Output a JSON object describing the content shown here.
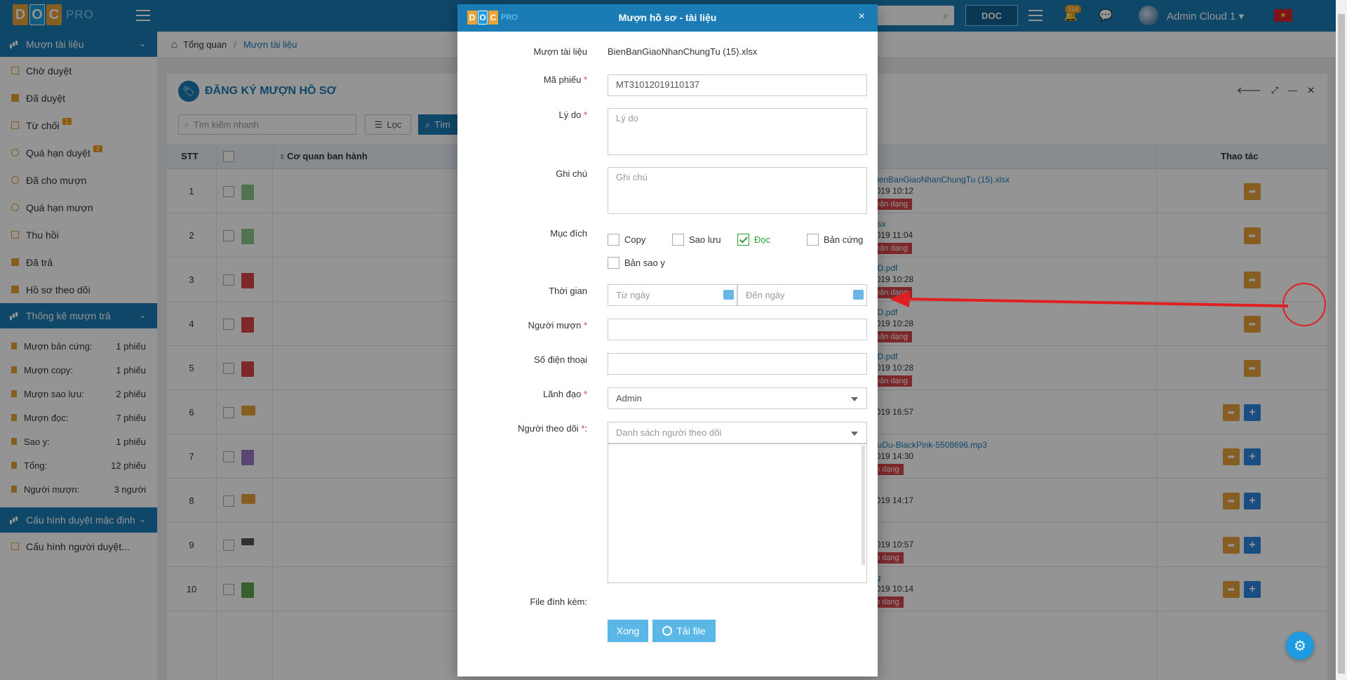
{
  "topbar": {
    "logo_letters": [
      "D",
      "O",
      "C"
    ],
    "logo_suffix": "PRO",
    "logo_colors": [
      "#e8a33a",
      "#1e9be0",
      "#e8a33a"
    ],
    "notification_count": "524",
    "user_name": "Admin Cloud 1",
    "user_caret": "▾"
  },
  "sidebar": {
    "section1": {
      "title": "Mượn tài liệu",
      "chevron": "⌄"
    },
    "items1": [
      {
        "label": "Chờ duyệt",
        "icon": "square-icon",
        "badge": ""
      },
      {
        "label": "Đã duyệt",
        "icon": "checked-square-icon",
        "badge": ""
      },
      {
        "label": "Từ chối",
        "icon": "minus-square-icon",
        "badge": "1"
      },
      {
        "label": "Quá hạn duyệt",
        "icon": "circle-icon",
        "badge": "2"
      },
      {
        "label": "Đã cho mượn",
        "icon": "dot-circle-icon",
        "badge": ""
      },
      {
        "label": "Quá hạn mượn",
        "icon": "circle-icon",
        "badge": ""
      },
      {
        "label": "Thu hồi",
        "icon": "minus-square-icon",
        "badge": ""
      },
      {
        "label": "Đã trả",
        "icon": "checked-square-icon",
        "badge": ""
      },
      {
        "label": "Hồ sơ theo dõi",
        "icon": "checked-square-icon",
        "badge": ""
      }
    ],
    "section2": {
      "title": "Thống kê mượn trả",
      "chevron": "⌄"
    },
    "stats": [
      {
        "label": "Mượn bản cứng:",
        "value": "1 phiếu"
      },
      {
        "label": "Mượn copy:",
        "value": "1 phiếu"
      },
      {
        "label": "Mượn sao lưu:",
        "value": "2 phiếu"
      },
      {
        "label": "Mượn đọc:",
        "value": "7 phiếu"
      },
      {
        "label": "Sao y:",
        "value": "1 phiếu"
      },
      {
        "label": "Tổng:",
        "value": "12 phiếu"
      },
      {
        "label": "Người mượn:",
        "value": "3 người"
      }
    ],
    "section3": {
      "title": "Cấu hình duyệt mặc định",
      "chevron": "⌄"
    },
    "items3": [
      {
        "label": "Cấu hình người duyệt..."
      }
    ]
  },
  "breadcrumb": {
    "home": "Tổng quan",
    "sep": "/",
    "current": "Mượn tài liệu"
  },
  "panel": {
    "title": "ĐĂNG KÝ MƯỢN HỒ SƠ",
    "quick_search_placeholder": "Tìm kiếm nhanh",
    "filter_label": "Lọc",
    "search_label": "Tìm",
    "columns": {
      "stt": "STT",
      "agency": "Cơ quan ban hành",
      "actions": "Thao tác"
    },
    "rows": [
      {
        "stt": "1",
        "type": "xls",
        "name": "BienBanGiaoNhanChungTu (15).xlsx",
        "date": "2019 10:12",
        "status": "hận dạng",
        "plus": false
      },
      {
        "stt": "2",
        "type": "xls",
        "name": "xlsx",
        "date": "2019 11:04",
        "status": "hận dạng",
        "plus": false
      },
      {
        "stt": "3",
        "type": "pdf",
        "name": "ND.pdf",
        "date": "2019 10:28",
        "status": "hận dạng",
        "plus": false
      },
      {
        "stt": "4",
        "type": "pdf",
        "name": "ND.pdf",
        "date": "2019 10:28",
        "status": "hận dạng",
        "plus": false
      },
      {
        "stt": "5",
        "type": "pdf",
        "name": "ND.pdf",
        "date": "2019 10:28",
        "status": "hận dạng",
        "plus": false
      },
      {
        "stt": "6",
        "type": "folder",
        "name": "",
        "date": "2019 16:57",
        "status": "",
        "plus": true
      },
      {
        "stt": "7",
        "type": "mp3",
        "name": "DuDu-BlackPink-5508696.mp3",
        "date": "2019 14:30",
        "status": "n dạng",
        "plus": true
      },
      {
        "stt": "8",
        "type": "folder",
        "name": "",
        "date": "2019 14:17",
        "status": "",
        "plus": true
      },
      {
        "stt": "9",
        "type": "exe",
        "name": "",
        "date": "2019 10:57",
        "status": "n dạng",
        "plus": true
      },
      {
        "stt": "10",
        "type": "img",
        "name": "ng",
        "date": "2019 10:14",
        "status": "n dạng",
        "plus": true
      }
    ]
  },
  "modal": {
    "title": "Mượn hồ sơ - tài liệu",
    "close": "×",
    "fields": {
      "document_label": "Mượn tài liệu",
      "document_value": "BienBanGiaoNhanChungTu (15).xlsx",
      "code_label": "Mã phiếu",
      "code_value": "MT31012019110137",
      "reason_label": "Lý do",
      "reason_placeholder": "Lý do",
      "note_label": "Ghi chú",
      "note_placeholder": "Ghi chú",
      "purpose_label": "Mục đích",
      "purposes": [
        {
          "label": "Copy",
          "checked": false
        },
        {
          "label": "Sao lưu",
          "checked": false
        },
        {
          "label": "Đọc",
          "checked": true
        },
        {
          "label": "Bản cứng",
          "checked": false
        },
        {
          "label": "Bản sao y",
          "checked": false
        }
      ],
      "time_label": "Thời gian",
      "from_placeholder": "Từ ngày",
      "to_placeholder": "Đến ngày",
      "borrower_label": "Người mượn",
      "phone_label": "Số điện thoại",
      "leader_label": "Lãnh đạo",
      "leader_value": "Admin",
      "followers_label": "Người theo dõi",
      "followers_placeholder": "Danh sách người theo dõi",
      "attachment_label": "File đính kèm:",
      "required_mark": "*"
    },
    "buttons": {
      "done": "Xong",
      "upload": "Tải file"
    }
  },
  "colors": {
    "primary": "#1a7bb5",
    "accent_orange": "#e8a33a",
    "danger": "#d8454b",
    "checked_green": "#2d9c3a",
    "annotation_red": "#e02020"
  }
}
